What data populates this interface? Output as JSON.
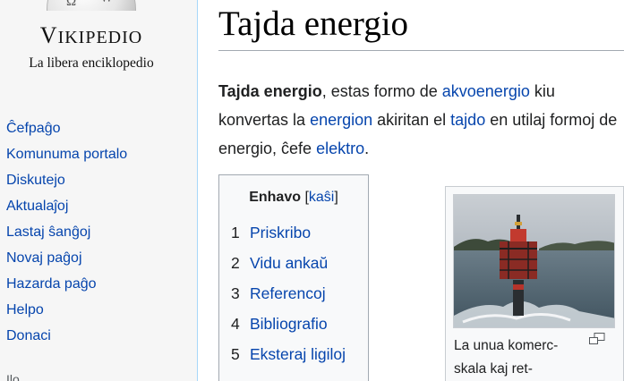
{
  "logo": {
    "wordmark_first": "V",
    "wordmark_rest": "IKIPEDIO",
    "tagline": "La libera enciklopedio"
  },
  "sidebar": {
    "items": [
      {
        "label": "Ĉefpaĝo"
      },
      {
        "label": "Komunuma portalo"
      },
      {
        "label": "Diskutejo"
      },
      {
        "label": "Aktualaĵoj"
      },
      {
        "label": "Lastaj ŝanĝoj"
      },
      {
        "label": "Novaj paĝoj"
      },
      {
        "label": "Hazarda paĝo"
      },
      {
        "label": "Helpo"
      },
      {
        "label": "Donaci"
      }
    ],
    "cutoff_text": "Ilo"
  },
  "article": {
    "title": "Tajda energio",
    "lead": {
      "bold_term": "Tajda energio",
      "t1": ", estas formo de ",
      "link1": "akvoenergio",
      "t2": " kiu konvertas la ",
      "link2": "energion",
      "t3": " akiritan el ",
      "link3": "tajdo",
      "t4": " en utilaj formoj de energio, ĉefe ",
      "link4": "elektro",
      "t5": "."
    }
  },
  "toc": {
    "title": "Enhavo",
    "bracket_open": " [",
    "toggle_label": "kaŝi",
    "bracket_close": "]",
    "items": [
      {
        "number": "1",
        "label": "Priskribo"
      },
      {
        "number": "2",
        "label": "Vidu ankaŭ"
      },
      {
        "number": "3",
        "label": "Referencoj"
      },
      {
        "number": "4",
        "label": "Bibliografio"
      },
      {
        "number": "5",
        "label": "Eksteraj ligiloj"
      }
    ]
  },
  "thumbnail": {
    "caption_line1": "La unua komerc-",
    "caption_line2": "skala kaj ret-",
    "icon": "enlarge-icon"
  },
  "colors": {
    "link": "#0645ad",
    "text": "#202122",
    "sidebar_bg": "#f6f6f6",
    "border": "#a2a9b1"
  }
}
